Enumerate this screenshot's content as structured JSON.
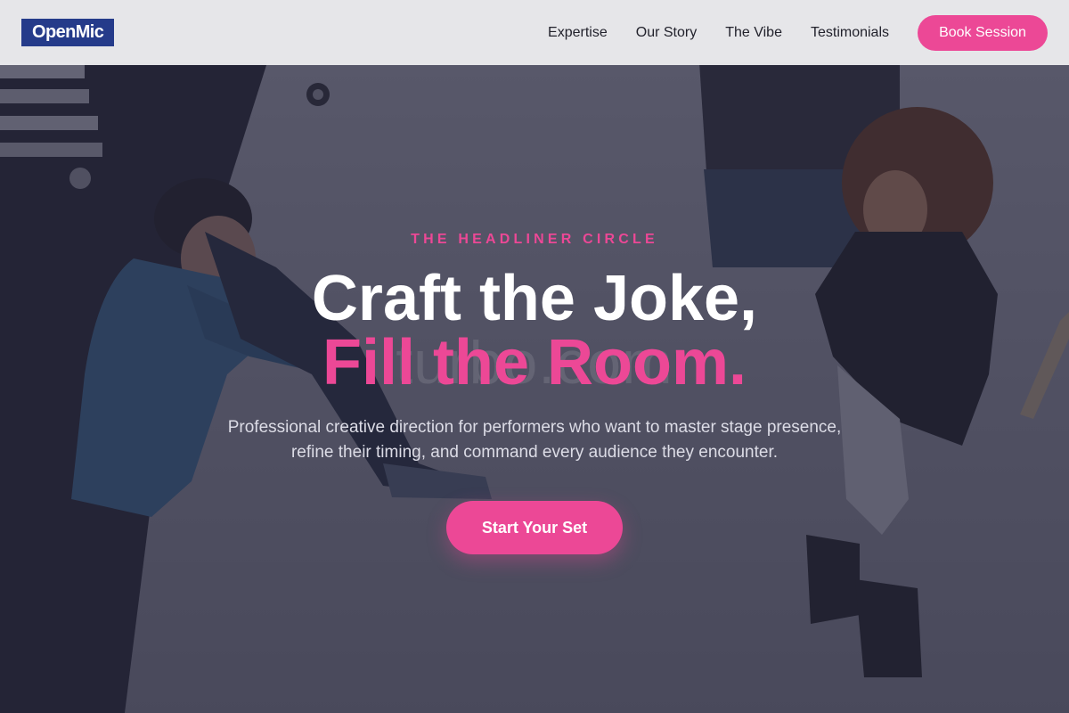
{
  "nav": {
    "logo": "OpenMic",
    "links": [
      "Expertise",
      "Our Story",
      "The Vibe",
      "Testimonials"
    ],
    "book_label": "Book Session"
  },
  "hero": {
    "eyebrow": "THE HEADLINER CIRCLE",
    "headline_line1": "Craft the Joke,",
    "headline_line2": "Fill the Room.",
    "subtext": "Professional creative direction for performers who want to master stage presence, refine their timing, and command every audience they encounter.",
    "cta_label": "Start Your Set",
    "watermark": "turbo.com"
  },
  "colors": {
    "accent": "#ec4896",
    "logo_bg": "#253b8a",
    "nav_bg": "#ececee",
    "overlay": "#26263e"
  }
}
